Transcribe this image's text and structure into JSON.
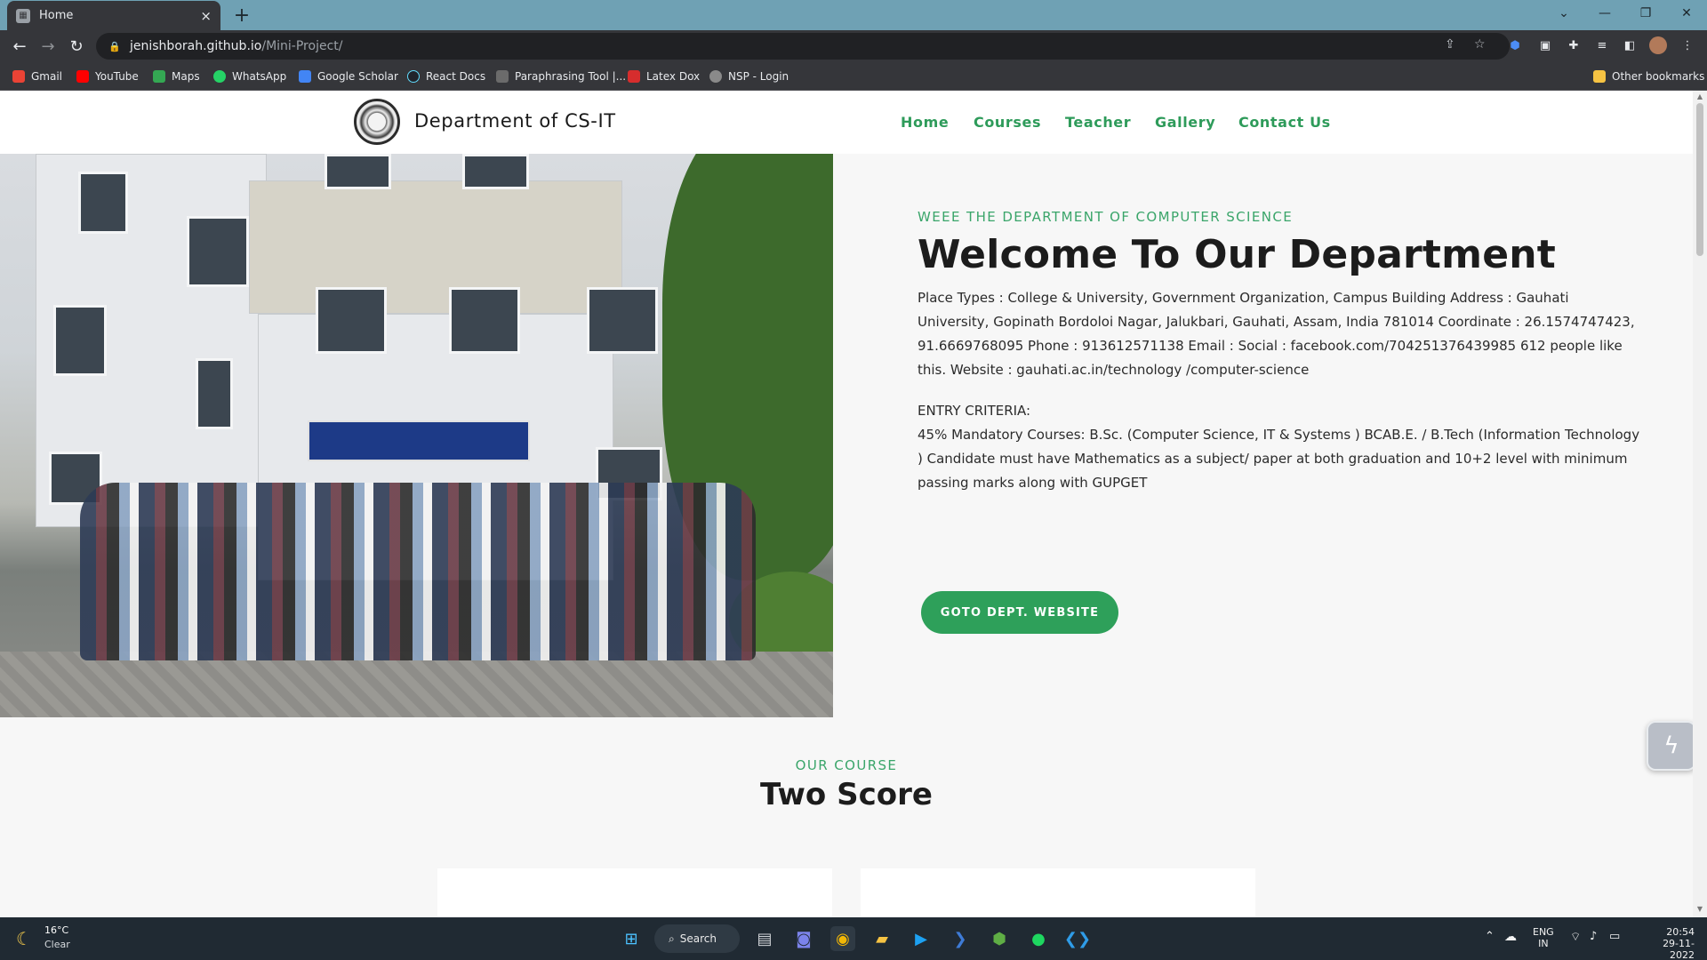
{
  "browser": {
    "tab_title": "Home",
    "tab_close": "×",
    "new_tab": "+",
    "url_host": "jenishborah.github.io",
    "url_path": "/Mini-Project/",
    "bookmarks": [
      "Gmail",
      "YouTube",
      "Maps",
      "WhatsApp",
      "Google Scholar",
      "React Docs",
      "Paraphrasing Tool |...",
      "Latex Dox",
      "NSP - Login"
    ],
    "other_bookmarks": "Other bookmarks"
  },
  "site": {
    "brand": "Department of CS-IT",
    "nav": [
      "Home",
      "Courses",
      "Teacher",
      "Gallery",
      "Contact Us"
    ],
    "eyebrow": "WEEE THE DEPARTMENT OF COMPUTER SCIENCE",
    "heading": "Welcome To Our Department",
    "paragraph1": "Place Types : College & University, Government Organization, Campus Building Address : Gauhati University, Gopinath Bordoloi Nagar, Jalukbari, Gauhati, Assam, India 781014 Coordinate : 26.1574747423, 91.6669768095 Phone : 913612571138 Email : Social : facebook.com/704251376439985 612 people like this. Website : gauhati.ac.in/technology /computer-science",
    "entry_title": "ENTRY CRITERIA:",
    "entry_text": "45% Mandatory Courses: B.Sc. (Computer Science, IT & Systems ) BCAB.E. / B.Tech (Information Technology ) Candidate must have Mathematics as a subject/ paper at both graduation and 10+2 level with minimum passing marks along with GUPGET",
    "cta": "GOTO DEPT. WEBSITE",
    "course_eyebrow": "OUR COURSE",
    "course_title": "Two Score"
  },
  "taskbar": {
    "temperature": "16°C",
    "condition": "Clear",
    "search": "Search",
    "lang_1": "ENG",
    "lang_2": "IN",
    "time": "20:54",
    "date": "29-11-2022"
  },
  "colors": {
    "accent_green": "#2ea05a",
    "tabbar": "#6fa1b4",
    "chrome_dark": "#35363a"
  }
}
